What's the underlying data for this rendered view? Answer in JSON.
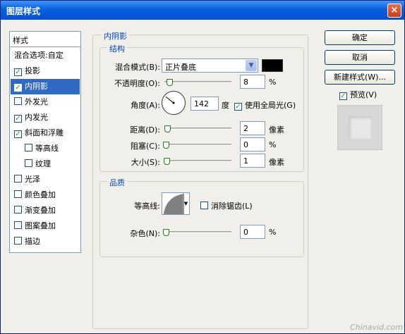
{
  "window": {
    "title": "图层样式",
    "close": "×"
  },
  "style_list": {
    "header": "样式",
    "items": [
      {
        "label": "混合选项:自定",
        "checkbox": false,
        "checked": false,
        "indent": false,
        "selected": false
      },
      {
        "label": "投影",
        "checkbox": true,
        "checked": true,
        "indent": false,
        "selected": false
      },
      {
        "label": "内阴影",
        "checkbox": true,
        "checked": true,
        "indent": false,
        "selected": true
      },
      {
        "label": "外发光",
        "checkbox": true,
        "checked": false,
        "indent": false,
        "selected": false
      },
      {
        "label": "内发光",
        "checkbox": true,
        "checked": true,
        "indent": false,
        "selected": false
      },
      {
        "label": "斜面和浮雕",
        "checkbox": true,
        "checked": true,
        "indent": false,
        "selected": false
      },
      {
        "label": "等高线",
        "checkbox": true,
        "checked": false,
        "indent": true,
        "selected": false
      },
      {
        "label": "纹理",
        "checkbox": true,
        "checked": false,
        "indent": true,
        "selected": false
      },
      {
        "label": "光泽",
        "checkbox": true,
        "checked": false,
        "indent": false,
        "selected": false
      },
      {
        "label": "颜色叠加",
        "checkbox": true,
        "checked": false,
        "indent": false,
        "selected": false
      },
      {
        "label": "渐变叠加",
        "checkbox": true,
        "checked": false,
        "indent": false,
        "selected": false
      },
      {
        "label": "图案叠加",
        "checkbox": true,
        "checked": false,
        "indent": false,
        "selected": false
      },
      {
        "label": "描边",
        "checkbox": true,
        "checked": false,
        "indent": false,
        "selected": false
      }
    ]
  },
  "inner_shadow": {
    "section_title": "内阴影",
    "structure": {
      "title": "结构",
      "blend_mode_label": "混合模式(B):",
      "blend_mode_value": "正片叠底",
      "blend_color": "#000000",
      "opacity_label": "不透明度(O):",
      "opacity_value": "8",
      "opacity_unit": "%",
      "angle_label": "角度(A):",
      "angle_value": "142",
      "angle_unit": "度",
      "global_light_label": "使用全局光(G)",
      "global_light_checked": true,
      "distance_label": "距离(D):",
      "distance_value": "2",
      "distance_unit": "像素",
      "choke_label": "阻塞(C):",
      "choke_value": "0",
      "choke_unit": "%",
      "size_label": "大小(S):",
      "size_value": "1",
      "size_unit": "像素"
    },
    "quality": {
      "title": "品质",
      "contour_label": "等高线:",
      "anti_alias_label": "消除锯齿(L)",
      "anti_alias_checked": false,
      "noise_label": "杂色(N):",
      "noise_value": "0",
      "noise_unit": "%"
    }
  },
  "buttons": {
    "ok": "确定",
    "cancel": "取消",
    "new_style": "新建样式(W)..."
  },
  "preview": {
    "label": "预览(V)",
    "checked": true
  },
  "watermark": "Chinavid.com",
  "colors": {
    "titlebar": "#0a5fdc",
    "selection": "#316ac5",
    "group_title": "#0046d5",
    "check": "#21a121"
  }
}
